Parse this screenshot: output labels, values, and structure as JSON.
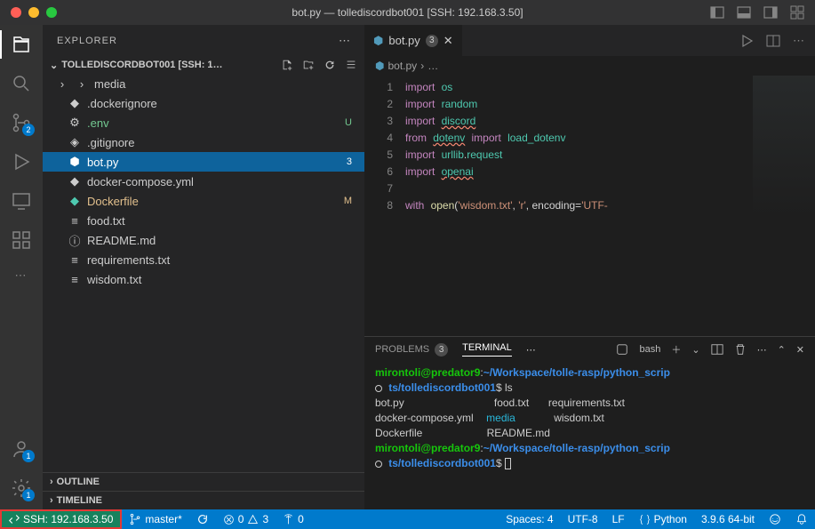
{
  "titlebar": {
    "title": "bot.py — tollediscordbot001 [SSH: 192.168.3.50]"
  },
  "activity": {
    "scm_badge": "2",
    "accounts_badge": "1",
    "settings_badge": "1"
  },
  "explorer": {
    "title": "EXPLORER",
    "section": "TOLLEDISCORDBOT001 [SSH: 1…",
    "items": [
      {
        "name": "media",
        "icon_name": "folder-icon",
        "folder": true
      },
      {
        "name": ".dockerignore",
        "icon_name": "docker-icon"
      },
      {
        "name": ".env",
        "icon_name": "gear-icon",
        "status": "U",
        "unt": true
      },
      {
        "name": ".gitignore",
        "icon_name": "git-icon"
      },
      {
        "name": "bot.py",
        "icon_name": "python-icon",
        "status": "3",
        "selected": true
      },
      {
        "name": "docker-compose.yml",
        "icon_name": "docker-icon"
      },
      {
        "name": "Dockerfile",
        "icon_name": "docker-icon",
        "status": "M",
        "mod": true
      },
      {
        "name": "food.txt",
        "icon_name": "text-icon"
      },
      {
        "name": "README.md",
        "icon_name": "info-icon"
      },
      {
        "name": "requirements.txt",
        "icon_name": "text-icon"
      },
      {
        "name": "wisdom.txt",
        "icon_name": "text-icon"
      }
    ],
    "outline": "OUTLINE",
    "timeline": "TIMELINE"
  },
  "editor": {
    "tab_name": "bot.py",
    "tab_badge": "3",
    "breadcrumb_file": "bot.py",
    "breadcrumb_more": "…",
    "lines": [
      "1",
      "2",
      "3",
      "4",
      "5",
      "6",
      "7",
      "8"
    ]
  },
  "panel": {
    "problems": "PROBLEMS",
    "problems_count": "3",
    "terminal": "TERMINAL",
    "shell": "bash",
    "t_user": "mirontoli@predator9",
    "t_path": "~/Workspace/tolle-rasp/python_scrip",
    "t_path2": "ts/tollediscordbot001",
    "t_cmd": "ls",
    "ls_c1r1": "bot.py",
    "ls_c2r1": "food.txt",
    "ls_c3r1": "requirements.txt",
    "ls_c1r2": "docker-compose.yml",
    "ls_c2r2": "media",
    "ls_c3r2": "wisdom.txt",
    "ls_c1r3": "Dockerfile",
    "ls_c2r3": "README.md"
  },
  "statusbar": {
    "remote": "SSH: 192.168.3.50",
    "branch": "master*",
    "errors": "0",
    "warnings": "3",
    "ports": "0",
    "spaces": "Spaces: 4",
    "encoding": "UTF-8",
    "eol": "LF",
    "lang": "Python",
    "version": "3.9.6 64-bit"
  }
}
